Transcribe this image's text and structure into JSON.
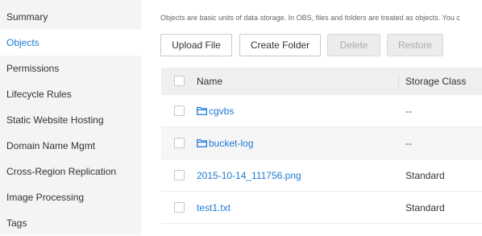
{
  "sidebar": {
    "items": [
      {
        "label": "Summary",
        "active": false
      },
      {
        "label": "Objects",
        "active": true
      },
      {
        "label": "Permissions",
        "active": false
      },
      {
        "label": "Lifecycle Rules",
        "active": false
      },
      {
        "label": "Static Website Hosting",
        "active": false
      },
      {
        "label": "Domain Name Mgmt",
        "active": false
      },
      {
        "label": "Cross-Region Replication",
        "active": false
      },
      {
        "label": "Image Processing",
        "active": false
      },
      {
        "label": "Tags",
        "active": false
      }
    ]
  },
  "main": {
    "intro_text": "Objects are basic units of data storage. In OBS, files and folders are treated as objects. You c",
    "toolbar": {
      "upload_label": "Upload File",
      "create_folder_label": "Create Folder",
      "delete_label": "Delete",
      "restore_label": "Restore"
    },
    "table": {
      "columns": [
        "Name",
        "Storage Class"
      ],
      "rows": [
        {
          "name": "cgvbs",
          "type": "folder",
          "icon": "folder-icon",
          "storage_class": "--"
        },
        {
          "name": "bucket-log",
          "type": "folder",
          "icon": "folder-icon",
          "storage_class": "--"
        },
        {
          "name": "2015-10-14_111756.png",
          "type": "file",
          "storage_class": "Standard"
        },
        {
          "name": "test1.txt",
          "type": "file",
          "storage_class": "Standard"
        }
      ]
    }
  },
  "colors": {
    "accent": "#1e7ad3",
    "sidebar_bg": "#f4f4f4",
    "header_bg": "#efefef",
    "disabled_bg": "#ececec"
  }
}
